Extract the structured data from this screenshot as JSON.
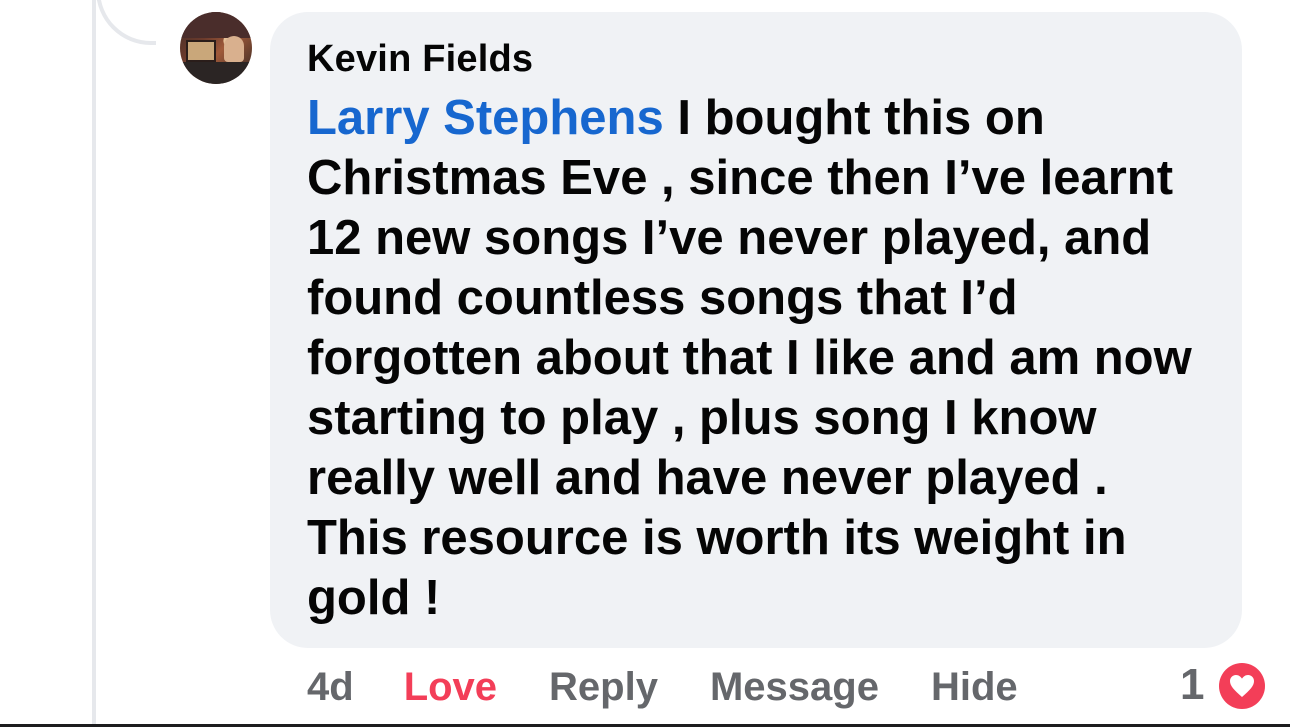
{
  "comment": {
    "author": "Kevin Fields",
    "mention": "Larry Stephens",
    "text": " I bought this on Christmas Eve , since then I’ve learnt 12 new songs I’ve never played, and found countless songs that I’d forgotten about that I like and am now starting to play , plus song I know really well and have never played .  This resource is worth its weight in gold !"
  },
  "actions": {
    "timestamp": "4d",
    "love_label": "Love",
    "reply_label": "Reply",
    "message_label": "Message",
    "hide_label": "Hide"
  },
  "reactions": {
    "count": "1",
    "type_icon": "heart-icon"
  },
  "colors": {
    "bubble": "#f0f2f5",
    "mention": "#1767cf",
    "love": "#f33e58",
    "secondary_text": "#65676b"
  }
}
